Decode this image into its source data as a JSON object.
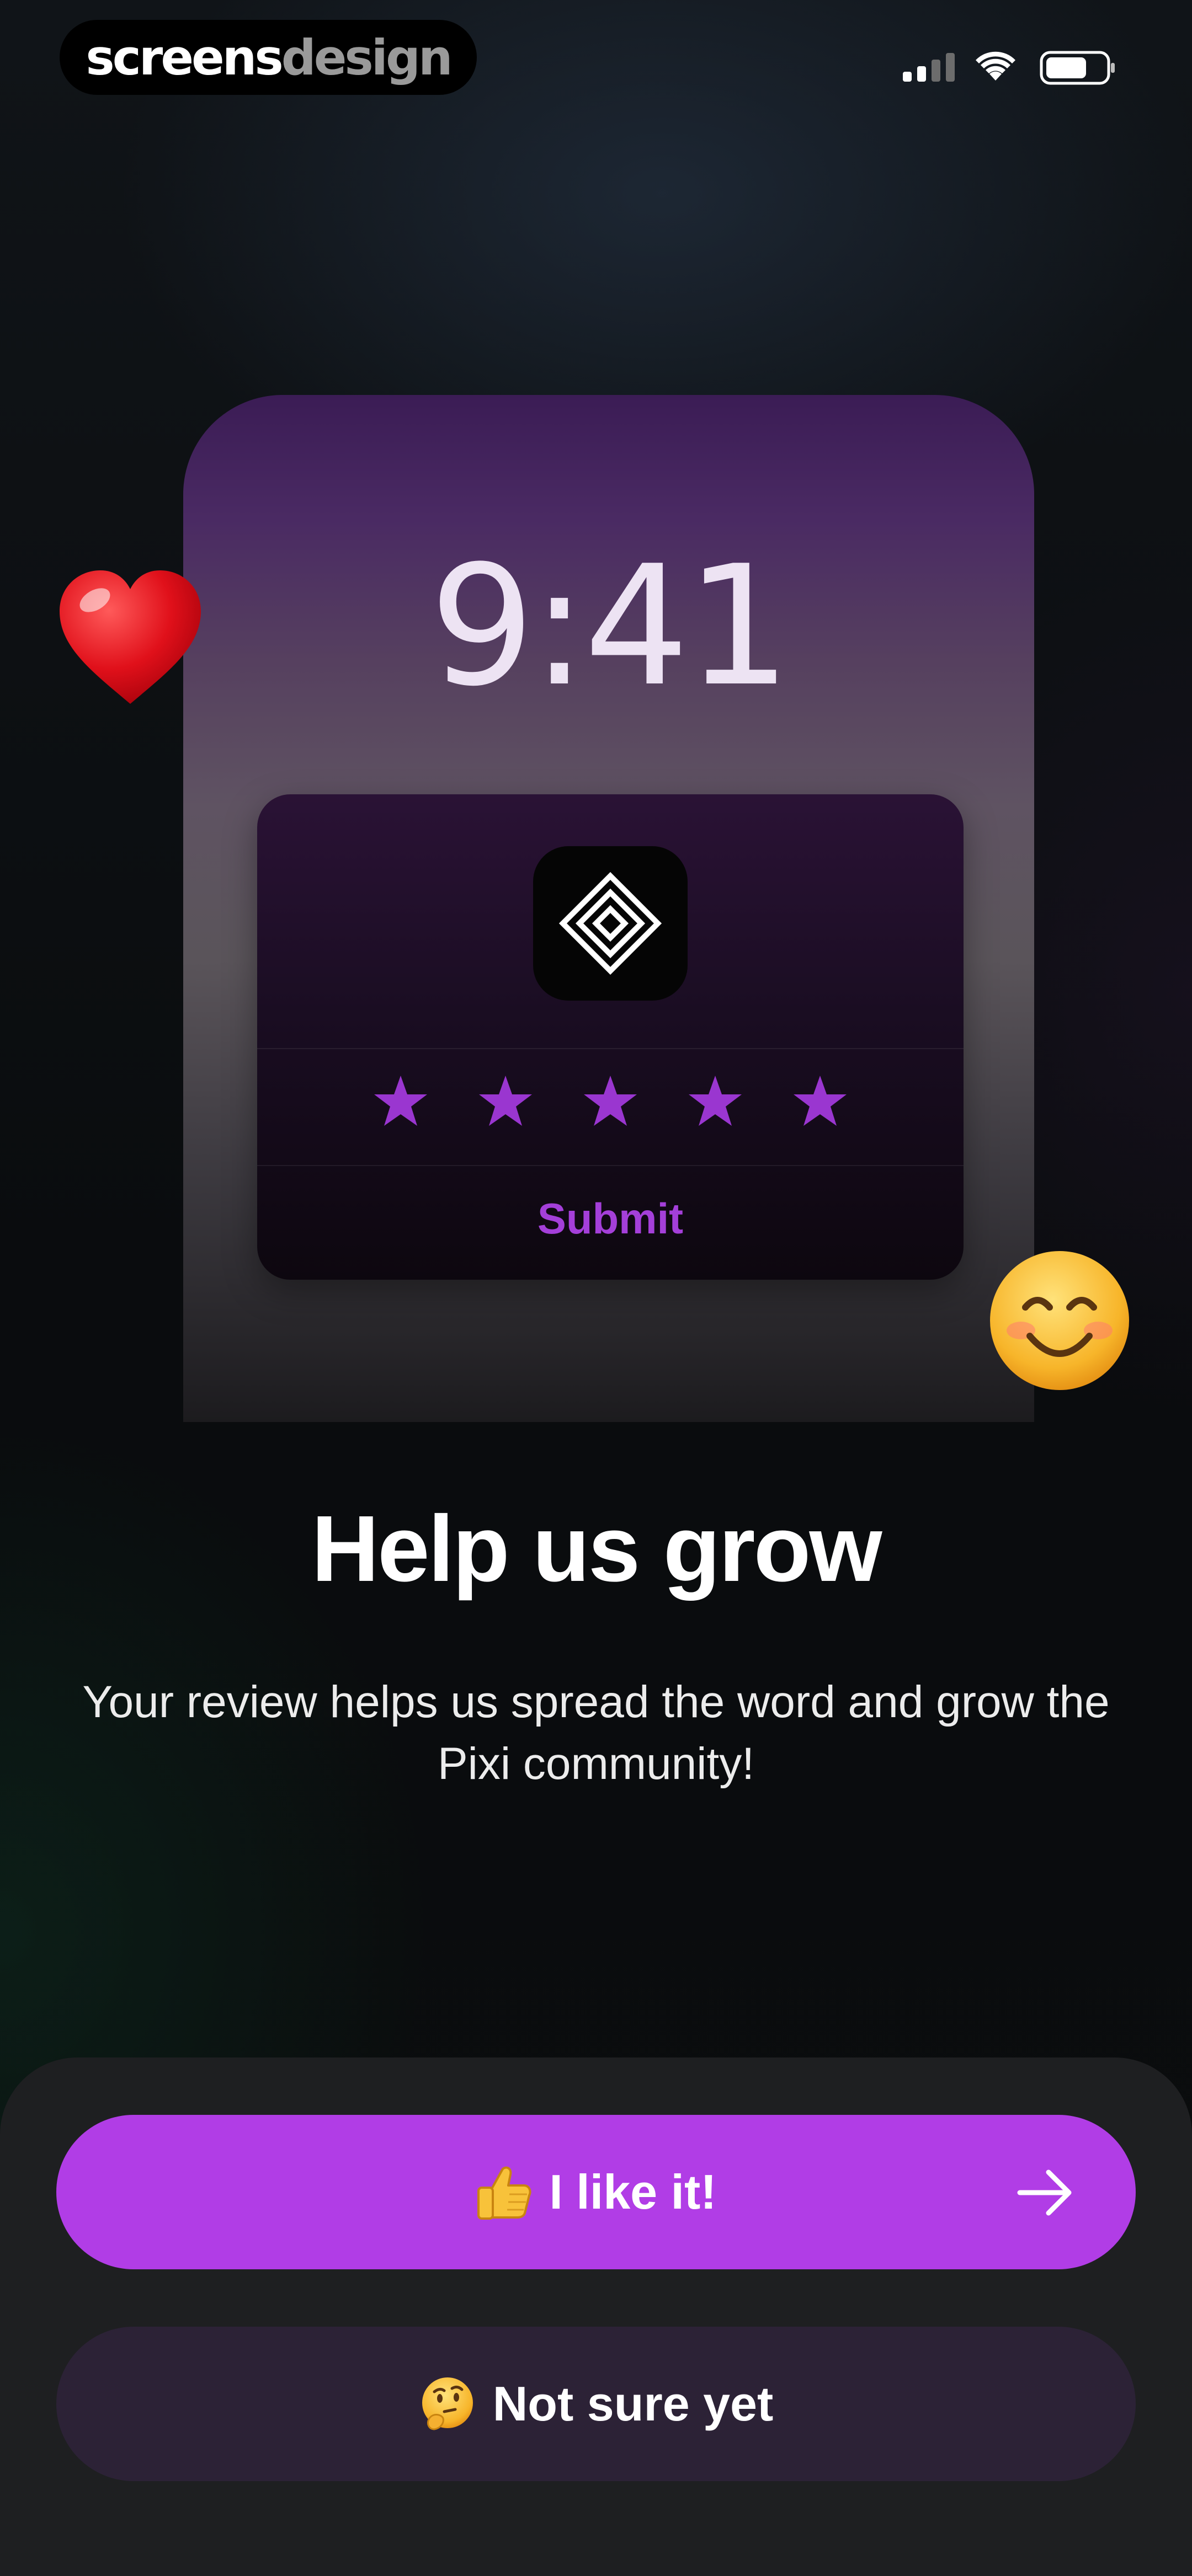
{
  "watermark": {
    "part1": "screens",
    "part2": "design"
  },
  "status_bar": {
    "icons": [
      "cellular-signal-icon",
      "wifi-icon",
      "battery-icon"
    ]
  },
  "mockup": {
    "time": "9:41",
    "app_icon": "diamond-logo-icon",
    "rating_stars": 5,
    "star_color": "#9a36d0",
    "submit_label": "Submit"
  },
  "decorations": {
    "left": "red-heart-emoji",
    "right": "smiling-face-emoji"
  },
  "content": {
    "title": "Help us grow",
    "subtitle": "Your review helps us spread the word and grow the Pixi community!"
  },
  "actions": {
    "primary": {
      "icon": "thumbs-up-emoji",
      "label": "I like it!",
      "trailing_icon": "arrow-right-icon",
      "color": "#b13de6"
    },
    "secondary": {
      "icon": "thinking-face-emoji",
      "label": "Not sure yet",
      "color": "#2c2236"
    }
  }
}
